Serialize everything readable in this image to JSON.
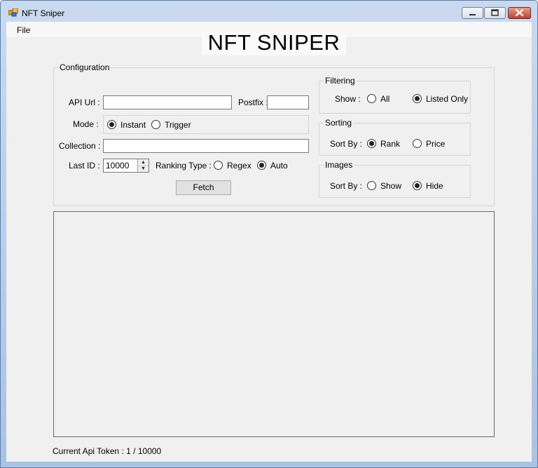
{
  "window": {
    "title": "NFT Sniper"
  },
  "menu": {
    "file": "File"
  },
  "heading": "NFT SNIPER",
  "config": {
    "group_label": "Configuration",
    "api_url_label": "API Url :",
    "api_url_value": "",
    "postfix_label": "Postfix :",
    "postfix_value": "",
    "mode_label": "Mode :",
    "mode_options": [
      "Instant",
      "Trigger"
    ],
    "mode_selected": "Instant",
    "collection_label": "Collection :",
    "collection_value": "",
    "last_id_label": "Last ID :",
    "last_id_value": "10000",
    "ranking_type_label": "Ranking Type :",
    "ranking_options": [
      "Regex",
      "Auto"
    ],
    "ranking_selected": "Auto",
    "fetch_label": "Fetch"
  },
  "filtering": {
    "group_label": "Filtering",
    "show_label": "Show :",
    "options": [
      "All",
      "Listed Only"
    ],
    "selected": "Listed Only"
  },
  "sorting": {
    "group_label": "Sorting",
    "sort_label": "Sort By :",
    "options": [
      "Rank",
      "Price"
    ],
    "selected": "Rank"
  },
  "images": {
    "group_label": "Images",
    "sort_label": "Sort By :",
    "options": [
      "Show",
      "Hide"
    ],
    "selected": "Hide"
  },
  "status": {
    "text": "Current Api Token : 1 / 10000"
  }
}
